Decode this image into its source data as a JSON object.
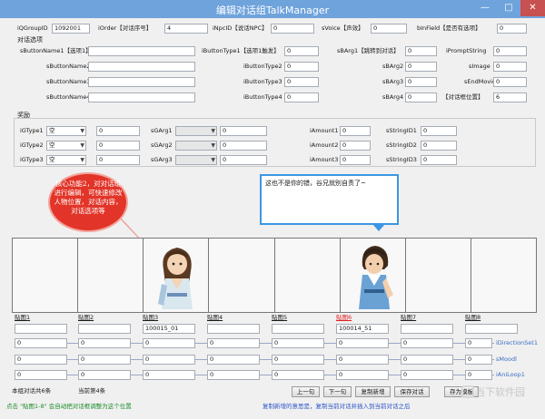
{
  "window": {
    "title": "编辑对话组TalkManager",
    "min": "—",
    "max": "□",
    "close": "✕"
  },
  "top": [
    {
      "label": "iQGroupID",
      "value": "1092001"
    },
    {
      "label": "iOrder【对话序号】",
      "value": "4"
    },
    {
      "label": "iNpcID【说话NPC】",
      "value": "0"
    },
    {
      "label": "sVoice【声效】",
      "value": "0"
    },
    {
      "label": "bInField【是否有选项】",
      "value": "0"
    }
  ],
  "options": {
    "title": "对话选项",
    "names": [
      {
        "label": "sButtonName1【选项1】",
        "value": ""
      },
      {
        "label": "sButtonName2",
        "value": ""
      },
      {
        "label": "sButtonName3",
        "value": ""
      },
      {
        "label": "sButtonName4",
        "value": ""
      }
    ],
    "types": [
      {
        "label": "iButtonType1【选项1触发】",
        "value": "0"
      },
      {
        "label": "iButtonType2",
        "value": "0"
      },
      {
        "label": "iButtonType3",
        "value": "0"
      },
      {
        "label": "iButtonType4",
        "value": "0"
      }
    ],
    "args": [
      {
        "label": "sBArg1【跳转到对话】",
        "value": "0"
      },
      {
        "label": "sBArg2",
        "value": "0"
      },
      {
        "label": "sBArg3",
        "value": "0"
      },
      {
        "label": "sBArg4",
        "value": "0"
      }
    ],
    "extras": [
      {
        "label": "iPromptString",
        "value": "0"
      },
      {
        "label": "sImage",
        "value": "0"
      },
      {
        "label": "sEndMovie",
        "value": "0"
      },
      {
        "label": "【对话框位置】",
        "value": "6"
      }
    ]
  },
  "rewards": {
    "title": "奖励",
    "gtypes": [
      {
        "label": "iGType1",
        "value": "空",
        "num": "0"
      },
      {
        "label": "iGType2",
        "value": "空",
        "num": "0"
      },
      {
        "label": "iGType3",
        "value": "空",
        "num": "0"
      }
    ],
    "gargs": [
      {
        "label": "sGArg1",
        "num": "0"
      },
      {
        "label": "sGArg2",
        "num": "0"
      },
      {
        "label": "sGArg3",
        "num": "0"
      }
    ],
    "amounts": [
      {
        "label": "iAmount1",
        "value": "0"
      },
      {
        "label": "iAmount2",
        "value": "0"
      },
      {
        "label": "iAmount3",
        "value": "0"
      }
    ],
    "strings": [
      {
        "label": "sStringID1",
        "value": "0"
      },
      {
        "label": "sStringID2",
        "value": "0"
      },
      {
        "label": "sStringID3",
        "value": "0"
      }
    ]
  },
  "callout": {
    "line1": "核心功能2，对对话组",
    "line2": "进行编辑，可快速修改",
    "line3": "人物位置，对话内容，",
    "line4": "对话选项等"
  },
  "speech": {
    "text": "这也不是你的错，谷兄就别自责了~"
  },
  "slots": [
    {
      "label": "贴图1",
      "value": "",
      "highlight": false
    },
    {
      "label": "贴图2",
      "value": "",
      "highlight": false
    },
    {
      "label": "贴图3",
      "value": "100015_01",
      "highlight": false
    },
    {
      "label": "贴图4",
      "value": "",
      "highlight": false
    },
    {
      "label": "贴图5",
      "value": "",
      "highlight": false
    },
    {
      "label": "贴图6",
      "value": "100014_51",
      "highlight": true
    },
    {
      "label": "贴图7",
      "value": "",
      "highlight": false
    },
    {
      "label": "贴图8",
      "value": "",
      "highlight": false
    }
  ],
  "rows": [
    {
      "label": "iDirectionSet1",
      "values": [
        "0",
        "0",
        "0",
        "0",
        "0",
        "0",
        "0",
        "0"
      ]
    },
    {
      "label": "sMoodl",
      "values": [
        "0",
        "0",
        "0",
        "0",
        "0",
        "0",
        "0",
        "0"
      ]
    },
    {
      "label": "iAniLoop1",
      "values": [
        "0",
        "0",
        "0",
        "0",
        "0",
        "0",
        "0",
        "0"
      ]
    }
  ],
  "footer": {
    "total": "本组对话共6条",
    "current": "当前第4条",
    "hint": "点击 \"贴图1-8\" 会自动把对话框调整为这个位置",
    "buttons": {
      "prev": "上一句",
      "next": "下一句",
      "copy_new": "复制新增",
      "save": "保存对话",
      "save_template": "存为模板"
    },
    "note": "复制新增的意思是，复制当前对话并插入到当前对话之后"
  },
  "watermark": "当下软件园"
}
